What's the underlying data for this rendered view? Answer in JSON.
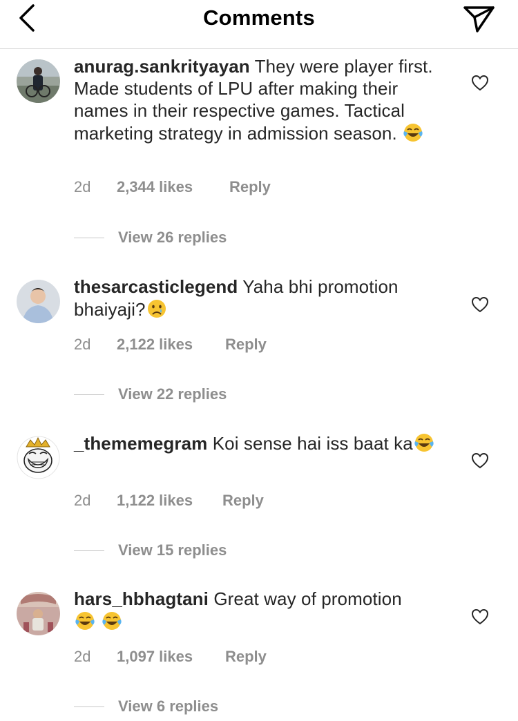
{
  "header": {
    "title": "Comments"
  },
  "comments": [
    {
      "username": "anurag.sankrityayan",
      "text": " They were player first. Made students of LPU after making their names in their respective games. Tactical marketing strategy in admission season. ",
      "emojis": [
        "face-with-tears-of-joy"
      ],
      "time": "2d",
      "likes": "2,344 likes",
      "reply": "Reply",
      "view_replies": "View 26 replies"
    },
    {
      "username": "thesarcasticlegend",
      "text": " Yaha bhi promotion bhaiyaji?",
      "emojis": [
        "crying-face"
      ],
      "time": "2d",
      "likes": "2,122 likes",
      "reply": "Reply",
      "view_replies": "View 22 replies"
    },
    {
      "username": "_thememegram",
      "text": " Koi sense hai iss baat ka",
      "emojis": [
        "face-with-tears-of-joy"
      ],
      "time": "2d",
      "likes": "1,122 likes",
      "reply": "Reply",
      "view_replies": "View 15 replies"
    },
    {
      "username": "hars_hbhagtani",
      "text": " Great way of promotion",
      "emojis": [
        "face-with-tears-of-joy",
        "face-with-tears-of-joy"
      ],
      "time": "2d",
      "likes": "1,097 likes",
      "reply": "Reply",
      "view_replies": "View 6 replies"
    }
  ],
  "colors": {
    "text": "#262626",
    "secondary": "#8e8e8e",
    "divider": "#dbdbdb"
  }
}
